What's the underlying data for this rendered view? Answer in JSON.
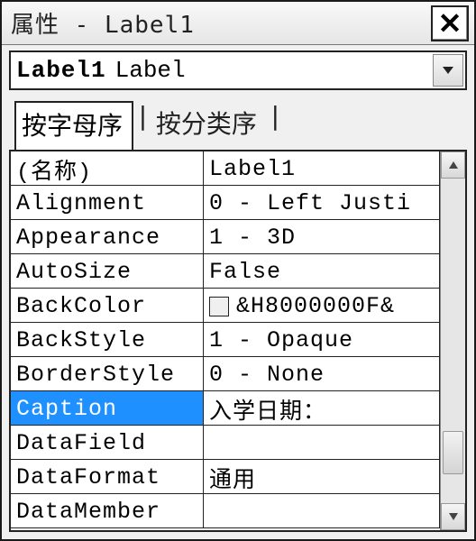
{
  "window_title": "属性 - Label1",
  "close_glyph": "✕",
  "object_selector": {
    "name": "Label1",
    "type": "Label"
  },
  "tabs": {
    "alphabetic": "按字母序",
    "categorized": "按分类序",
    "active": "alphabetic"
  },
  "properties": [
    {
      "name": "(名称)",
      "value": "Label1"
    },
    {
      "name": "Alignment",
      "value": "0 - Left Justi"
    },
    {
      "name": "Appearance",
      "value": "1 - 3D"
    },
    {
      "name": "AutoSize",
      "value": "False"
    },
    {
      "name": "BackColor",
      "value": "&H8000000F&",
      "has_swatch": true
    },
    {
      "name": "BackStyle",
      "value": "1 - Opaque"
    },
    {
      "name": "BorderStyle",
      "value": "0 - None"
    },
    {
      "name": "Caption",
      "value": "入学日期：",
      "selected": true
    },
    {
      "name": "DataField",
      "value": ""
    },
    {
      "name": "DataFormat",
      "value": "通用"
    },
    {
      "name": "DataMember",
      "value": ""
    }
  ]
}
